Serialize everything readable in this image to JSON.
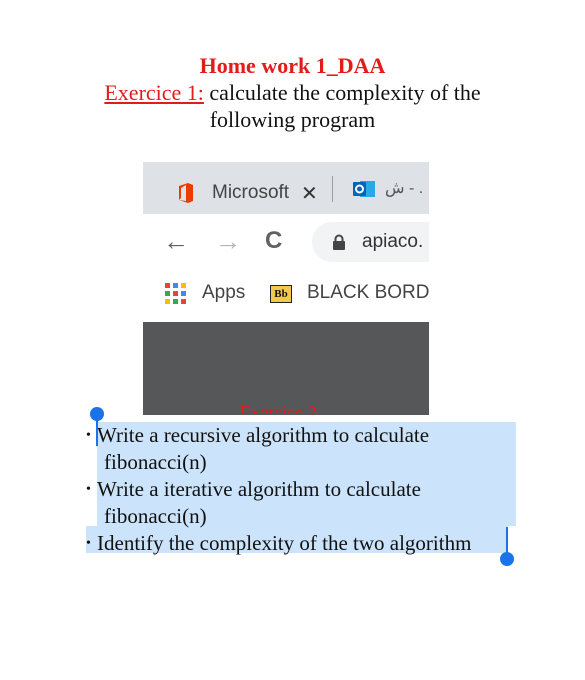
{
  "document": {
    "title": "Home work 1_DAA",
    "exercise_label": "Exercice 1:",
    "exercise_text_line1": " calculate the complexity of the",
    "exercise_text_line2": "following program",
    "covered_heading": "Exercice 2"
  },
  "embedded_screenshot": {
    "tab1_title": "Microsoft",
    "tab1_close": "✕",
    "tab2_title": "ش - .",
    "nav_back": "←",
    "nav_forward": "→",
    "nav_reload": "C",
    "url": "apiaco.",
    "bookmark_apps": "Apps",
    "bookmark_bb_icon": "Bb",
    "bookmark_bb": "BLACK BORD"
  },
  "bullets": [
    {
      "line1": "Write a recursive algorithm to calculate",
      "line2": "fibonacci(n)"
    },
    {
      "line1": "Write a iterative algorithm to calculate",
      "line2": "fibonacci(n)"
    },
    {
      "line1": "Identify the complexity of the two algorithm",
      "line2": ""
    }
  ],
  "bullet_symbol": "•",
  "colors": {
    "heading_red": "#e21b1b",
    "selection": "#cce4fb",
    "selection_handle": "#1a73e8",
    "dark_area": "#555759"
  },
  "icons": [
    "office-icon",
    "outlook-icon",
    "lock-icon",
    "apps-icon",
    "blackboard-icon"
  ]
}
